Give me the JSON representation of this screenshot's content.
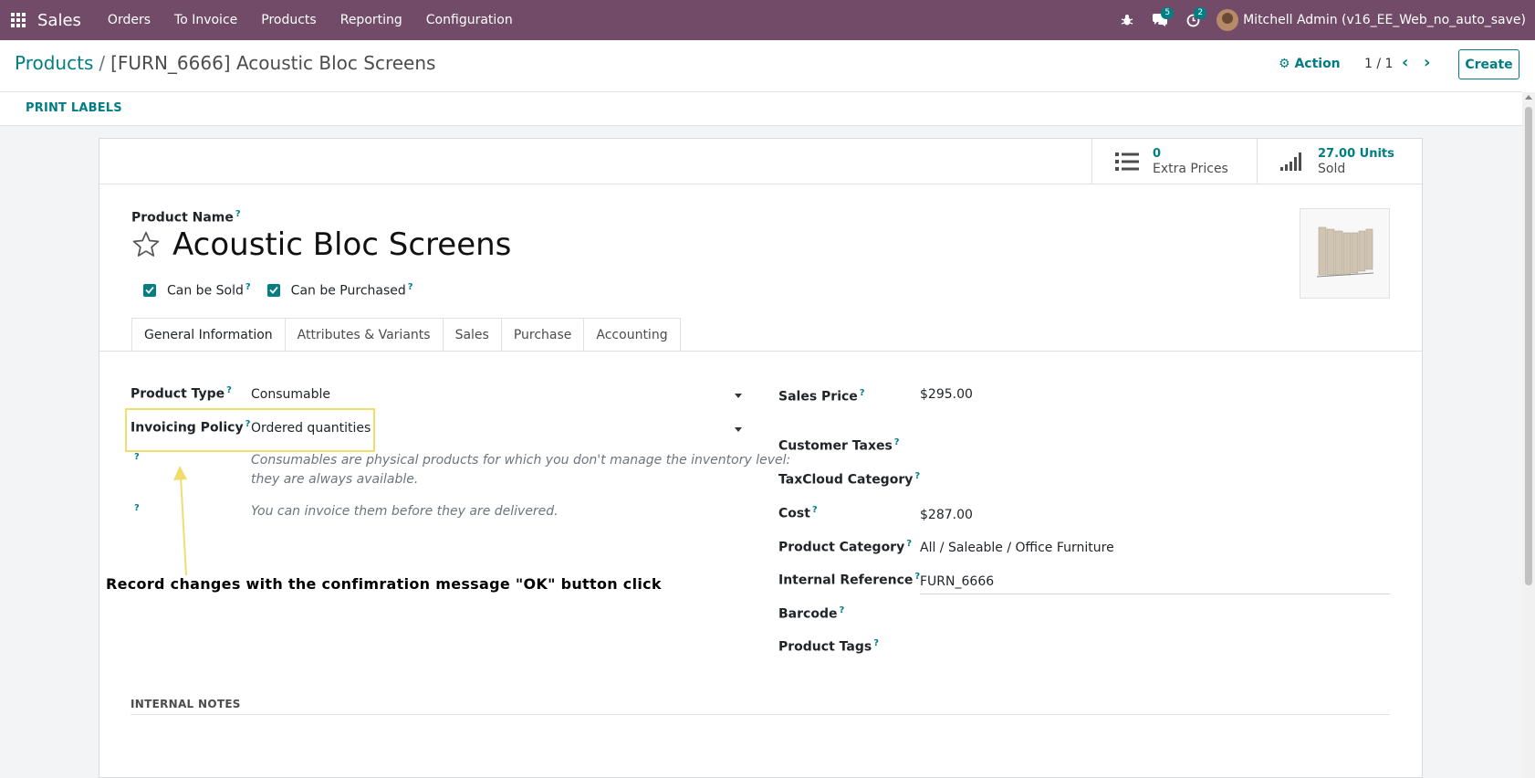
{
  "navbar": {
    "app_name": "Sales",
    "menu": [
      "Orders",
      "To Invoice",
      "Products",
      "Reporting",
      "Configuration"
    ],
    "messages_count": "5",
    "activities_count": "2",
    "user": "Mitchell Admin (v16_EE_Web_no_auto_save)",
    "bg_color": "#714b67"
  },
  "breadcrumb": {
    "parent": "Products",
    "separator": "/",
    "current": "[FURN_6666] Acoustic Bloc Screens"
  },
  "control": {
    "action_label": "Action",
    "pager": "1 / 1",
    "create_label": "Create"
  },
  "buttons": {
    "print_labels": "PRINT LABELS"
  },
  "smart_buttons": {
    "extra_prices_value": "0",
    "extra_prices_label": "Extra Prices",
    "sold_value": "27.00 Units",
    "sold_label": "Sold"
  },
  "product": {
    "name_label": "Product Name",
    "name": "Acoustic Bloc Screens",
    "can_be_sold_label": "Can be Sold",
    "can_be_purchased_label": "Can be Purchased",
    "can_be_sold": true,
    "can_be_purchased": true
  },
  "tabs": [
    "General Information",
    "Attributes & Variants",
    "Sales",
    "Purchase",
    "Accounting"
  ],
  "active_tab": "General Information",
  "left_fields": {
    "product_type_label": "Product Type",
    "product_type_value": "Consumable",
    "invoicing_policy_label": "Invoicing Policy",
    "invoicing_policy_value": "Ordered quantities",
    "hint_type_line1": "Consumables are physical products for which you don't manage the inventory level:",
    "hint_type_line2": "they are always available.",
    "hint_invoice": "You can invoice them before they are delivered."
  },
  "right_fields": {
    "sales_price_label": "Sales Price",
    "sales_price_value": "$295.00",
    "customer_taxes_label": "Customer Taxes",
    "taxcloud_label": "TaxCloud Category",
    "cost_label": "Cost",
    "cost_value": "$287.00",
    "product_category_label": "Product Category",
    "product_category_value": "All / Saleable / Office Furniture",
    "internal_reference_label": "Internal Reference",
    "internal_reference_value": "FURN_6666",
    "barcode_label": "Barcode",
    "product_tags_label": "Product Tags"
  },
  "internal_notes_label": "INTERNAL NOTES",
  "annotation": {
    "text": "Record changes with the confimration message \"OK\" button click",
    "color": "#f0dd6e"
  }
}
